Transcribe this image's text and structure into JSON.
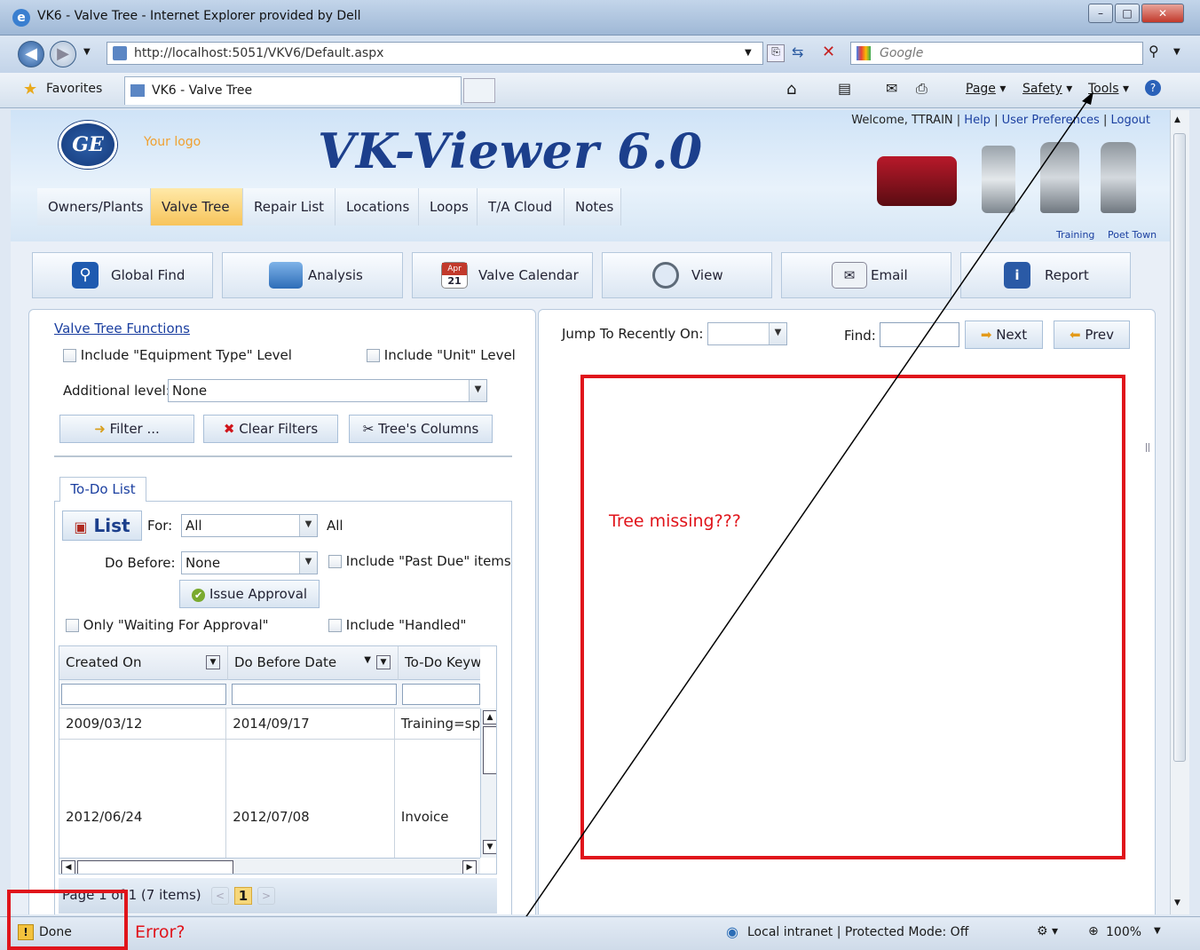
{
  "window": {
    "title": "VK6 - Valve Tree - Internet Explorer provided by Dell"
  },
  "addressbar": {
    "url": "http://localhost:5051/VKV6/Default.aspx",
    "search_placeholder": "Google"
  },
  "favbar": {
    "favorites": "Favorites",
    "tab": "VK6 - Valve Tree",
    "page": "Page",
    "safety": "Safety",
    "tools": "Tools"
  },
  "header": {
    "logo_text": "GE",
    "your_logo": "Your logo",
    "brand": "VK-Viewer 6.0",
    "welcome": "Welcome, TTRAIN",
    "help": "Help",
    "prefs": "User Preferences",
    "logout": "Logout",
    "training": "Training",
    "town": "Poet Town"
  },
  "nav": [
    "Owners/Plants",
    "Valve Tree",
    "Repair List",
    "Locations",
    "Loops",
    "T/A Cloud",
    "Notes"
  ],
  "toolbar": {
    "global_find": "Global Find",
    "analysis": "Analysis",
    "calendar": "Valve Calendar",
    "calendar_month": "Apr",
    "calendar_day": "21",
    "view": "View",
    "email": "Email",
    "report": "Report"
  },
  "left": {
    "functions_link": "Valve Tree Functions",
    "eq_type": "Include \"Equipment Type\" Level",
    "unit": "Include \"Unit\" Level",
    "additional_label": "Additional level:",
    "additional_value": "None",
    "filter": "Filter ...",
    "clear": "Clear Filters",
    "columns": "Tree's Columns",
    "todo_tab": "To-Do List",
    "list_btn": "List",
    "for_label": "For:",
    "for_value": "All",
    "for_after": "All",
    "do_before_label": "Do Before:",
    "do_before_value": "None",
    "past_due": "Include \"Past Due\" items",
    "issue_approval": "Issue Approval",
    "only_waiting": "Only \"Waiting For Approval\"",
    "handled": "Include \"Handled\"",
    "col_created": "Created On",
    "col_dobefore": "Do Before Date",
    "col_keyword": "To-Do Keyw",
    "rows": [
      {
        "created": "2009/03/12",
        "dobefore": "2014/09/17",
        "keyword": "Training=sp"
      },
      {
        "created": "2012/06/24",
        "dobefore": "2012/07/08",
        "keyword": "Invoice"
      }
    ],
    "pager_text": "Page 1 of 1 (7 items)",
    "pager_current": "1"
  },
  "right": {
    "jump_label": "Jump To Recently On:",
    "find_label": "Find:",
    "next": "Next",
    "prev": "Prev",
    "annotation": "Tree missing???"
  },
  "status": {
    "done": "Done",
    "error_annotation": "Error?",
    "zone": "Local intranet | Protected Mode: Off",
    "zoom": "100%"
  },
  "colors": {
    "annotation_red": "#e0141b",
    "active_tab": "#f7c45b",
    "brand_blue": "#1c3f8c"
  }
}
